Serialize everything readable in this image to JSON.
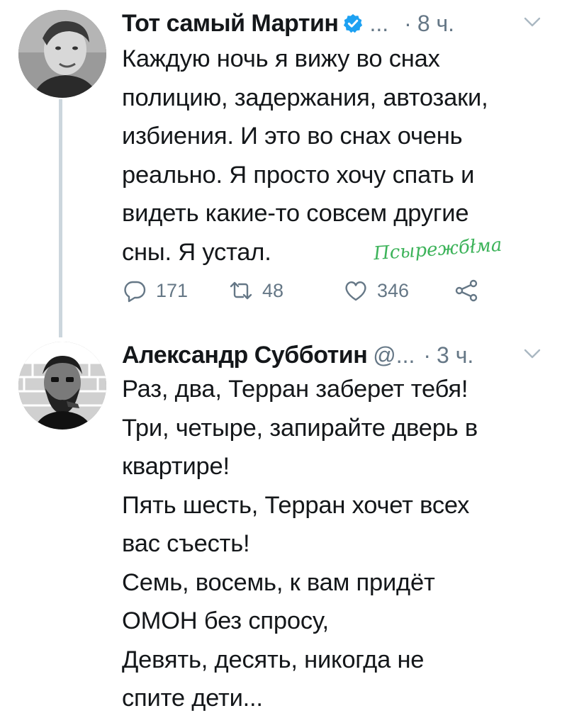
{
  "tweets": [
    {
      "author": "Тот самый Мартин",
      "handle": "...",
      "dot": "·",
      "time": "8 ч.",
      "verified": true,
      "text": "Каждую ночь я вижу во снах\nполицию, задержания, автозаки,\nизбиения. И это во снах очень\nреально. Я просто хочу спать и\nвидеть какие-то совсем другие\nсны. Я устал.",
      "replies": "171",
      "retweets": "48",
      "likes": "346"
    },
    {
      "author": "Александр Субботин",
      "handle": "@...",
      "dot": "·",
      "time": "3 ч.",
      "verified": false,
      "text": "Раз, два, Терран заберет тебя!\nТри, четыре, запирайте дверь в\nквартире!\nПять шесть, Терран хочет всех\nвас съесть!\nСемь, восемь, к вам придёт\nОМОН без спросу,\nДевять, десять, никогда не\nспите дети..."
    }
  ],
  "watermark": "Псырежбłма",
  "colors": {
    "text": "#14171a",
    "secondary": "#657786",
    "verified": "#1da1f2",
    "thread_line": "#ccd6dd",
    "watermark": "#3db35a"
  }
}
